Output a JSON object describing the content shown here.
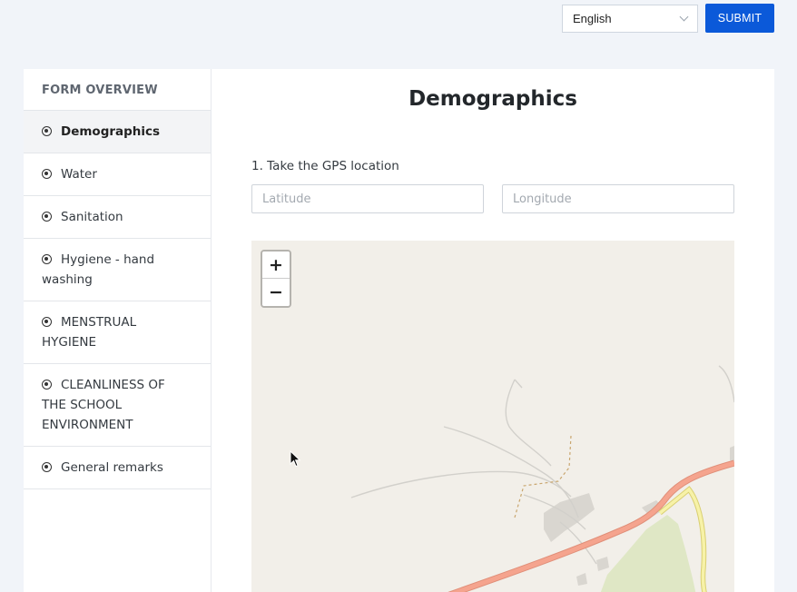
{
  "header": {
    "language": "English",
    "submit_label": "SUBMIT"
  },
  "sidebar": {
    "title": "FORM OVERVIEW",
    "items": [
      {
        "label": "Demographics",
        "active": true
      },
      {
        "label": "Water"
      },
      {
        "label": "Sanitation"
      },
      {
        "label": "Hygiene - hand washing"
      },
      {
        "label": "MENSTRUAL HYGIENE"
      },
      {
        "label": "CLEANLINESS OF THE SCHOOL ENVIRONMENT"
      },
      {
        "label": "General remarks"
      }
    ]
  },
  "main": {
    "title": "Demographics",
    "question": "1. Take the GPS location",
    "latitude": {
      "value": "",
      "placeholder": "Latitude"
    },
    "longitude": {
      "value": "",
      "placeholder": "Longitude"
    }
  },
  "map": {
    "zoom_in": "+",
    "zoom_out": "−",
    "colors": {
      "land": "#f2efe9",
      "primary_road": "#f5a48e",
      "secondary_road": "#f7f2a8",
      "park": "#dfe7c5",
      "building": "#d9d6d0",
      "minor_road": "#d2d0cb"
    }
  },
  "colors": {
    "accent": "#0b59d9",
    "background": "#f1f4f9"
  }
}
